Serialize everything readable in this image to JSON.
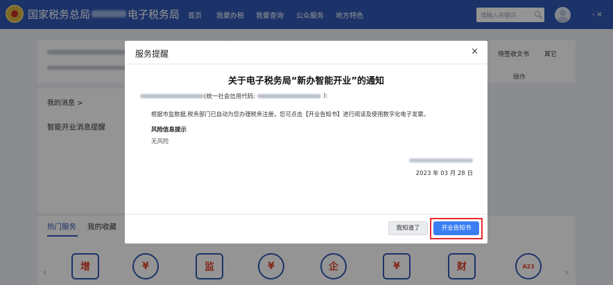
{
  "header": {
    "brand_left": "国家税务总局",
    "brand_right": "电子税务局",
    "nav": [
      "首页",
      "我要办税",
      "我要查询",
      "公众服务",
      "地方特色"
    ],
    "search_placeholder": "请输入关键词",
    "close_glyph": "×"
  },
  "background": {
    "right_tabs": [
      "待签收文书",
      "其它"
    ],
    "ops_label": "操作",
    "my_messages": "我的消息 >",
    "smart_reminder": "智能开业消息提醒",
    "hot_services_tab": "热门服务",
    "favorites_tab": "我的收藏",
    "arrow_left": "‹",
    "arrow_right": "›",
    "tile_icons": [
      "增",
      "¥",
      "监",
      "¥",
      "企",
      "¥",
      "财",
      "A23"
    ]
  },
  "modal": {
    "title": "服务提醒",
    "close": "×",
    "notice_title": "关于电子税务局“新办智能开业”的通知",
    "credit_code_prefix": "(统一社会信用代码:",
    "credit_code_suffix": "):",
    "body_text": "根据市监数据,税务部门已自动为您办理税务注册，您可点击【开业告知书】进行阅读及使用数字化电子发票。",
    "risk_title": "风险信息提示",
    "risk_value": "无风险",
    "date": "2023 年 03 月 28 日",
    "btn_know": "我知道了",
    "btn_open": "开业告知书"
  },
  "colors": {
    "brand_blue": "#2f59b6",
    "primary_button": "#3a7ef2",
    "highlight_red": "#e8262b"
  }
}
